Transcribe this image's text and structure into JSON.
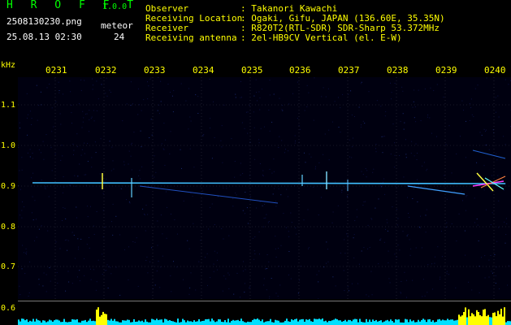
{
  "app": {
    "title": "H R O F F T",
    "version": "1.0.0"
  },
  "file": {
    "name": "2508130230.png",
    "datetime": "25.08.13 02:30"
  },
  "meteor": {
    "label": "meteor",
    "count": "24"
  },
  "meta": [
    {
      "key": "Observer",
      "value": ": Takanori Kawachi"
    },
    {
      "key": "Receiving Location",
      "value": ": Ogaki, Gifu, JAPAN (136.60E, 35.35N)"
    },
    {
      "key": "Receiver",
      "value": ": R820T2(RTL-SDR) SDR-Sharp 53.372MHz"
    },
    {
      "key": "Receiving antenna",
      "value": ": 2el-HB9CV Vertical (el. E-W)"
    }
  ],
  "axes": {
    "y_unit": "kHz",
    "time_ticks": [
      "0231",
      "0232",
      "0233",
      "0234",
      "0235",
      "0236",
      "0237",
      "0238",
      "0239",
      "0240"
    ],
    "freq_ticks": [
      "1.1",
      "1.0",
      "0.9",
      "0.8",
      "0.7",
      "0.6"
    ]
  },
  "colors": {
    "label_yellow": "#ffff00",
    "title_green": "#00ff00",
    "trace_cyan": "#40c0ff"
  }
}
